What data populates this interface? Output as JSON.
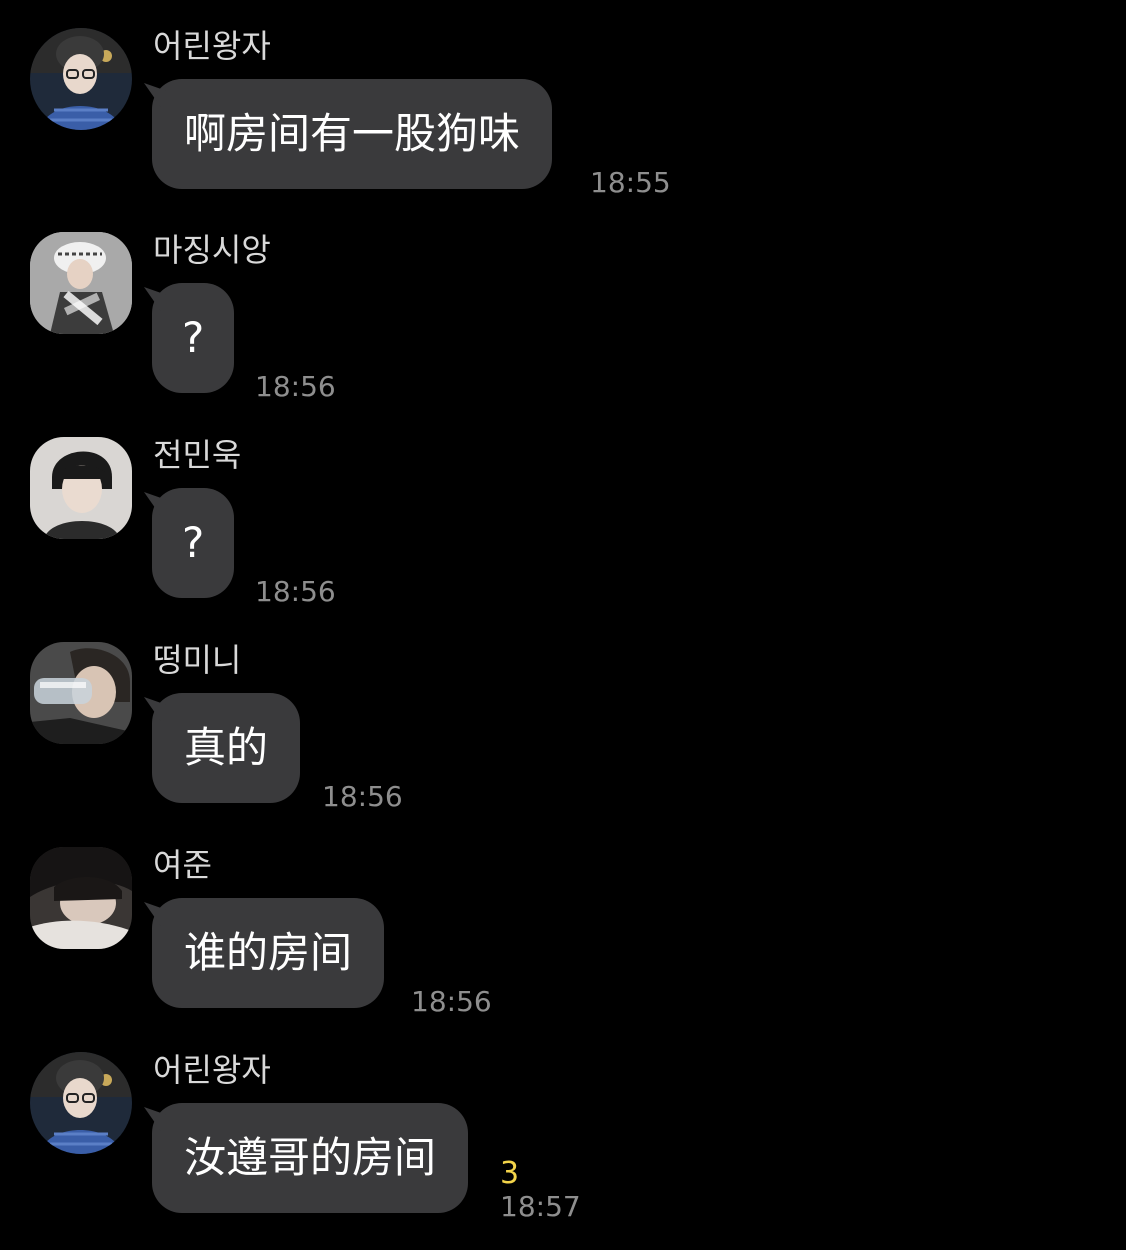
{
  "messages": [
    {
      "sender": "어린왕자",
      "text": "啊房间有一股狗味",
      "time": "18:55",
      "unread": "",
      "avatar": "boy-in-knit-hat-avatar"
    },
    {
      "sender": "마징시앙",
      "text": "?",
      "time": "18:56",
      "unread": "",
      "avatar": "bucket-hat-avatar"
    },
    {
      "sender": "전민욱",
      "text": "?",
      "time": "18:56",
      "unread": "",
      "avatar": "portrait-avatar"
    },
    {
      "sender": "떵미니",
      "text": "真的",
      "time": "18:56",
      "unread": "",
      "avatar": "face-with-bottle-avatar"
    },
    {
      "sender": "여준",
      "text": "谁的房间",
      "time": "18:56",
      "unread": "",
      "avatar": "lying-down-avatar"
    },
    {
      "sender": "어린왕자",
      "text": "汝遵哥的房间",
      "time": "18:57",
      "unread": "3",
      "avatar": "boy-in-knit-hat-avatar"
    }
  ],
  "colors": {
    "background": "#000000",
    "bubble": "#3a3a3c",
    "message_text": "#ffffff",
    "sender_text": "#d9d9d9",
    "time_text": "#8e8e8e",
    "unread_badge": "#f3d44a"
  }
}
